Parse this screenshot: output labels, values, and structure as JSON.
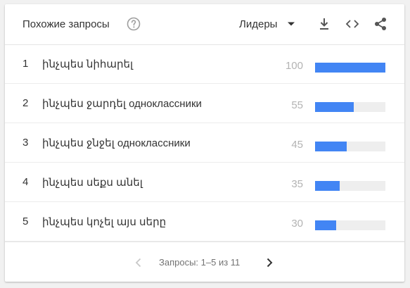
{
  "header": {
    "title": "Похожие запросы",
    "sort_label": "Лидеры",
    "icons": [
      "help-icon",
      "dropdown-icon",
      "download-icon",
      "embed-icon",
      "share-icon"
    ]
  },
  "rows": [
    {
      "rank": "1",
      "query": "ինչպես նիհարել",
      "value": "100"
    },
    {
      "rank": "2",
      "query": "ինչպես ջարդել одноклассники",
      "value": "55"
    },
    {
      "rank": "3",
      "query": "ինչպես ջնջել одноклассники",
      "value": "45"
    },
    {
      "rank": "4",
      "query": "ինչպես սեքս անել",
      "value": "35"
    },
    {
      "rank": "5",
      "query": "ինչպես կոչել այս սերը",
      "value": "30"
    }
  ],
  "footer": {
    "pagination": "Запросы: 1–5 из 11"
  },
  "colors": {
    "bar": "#4285f4",
    "track": "#eeeeee",
    "text": "#333333",
    "muted": "#b3b3b3"
  }
}
